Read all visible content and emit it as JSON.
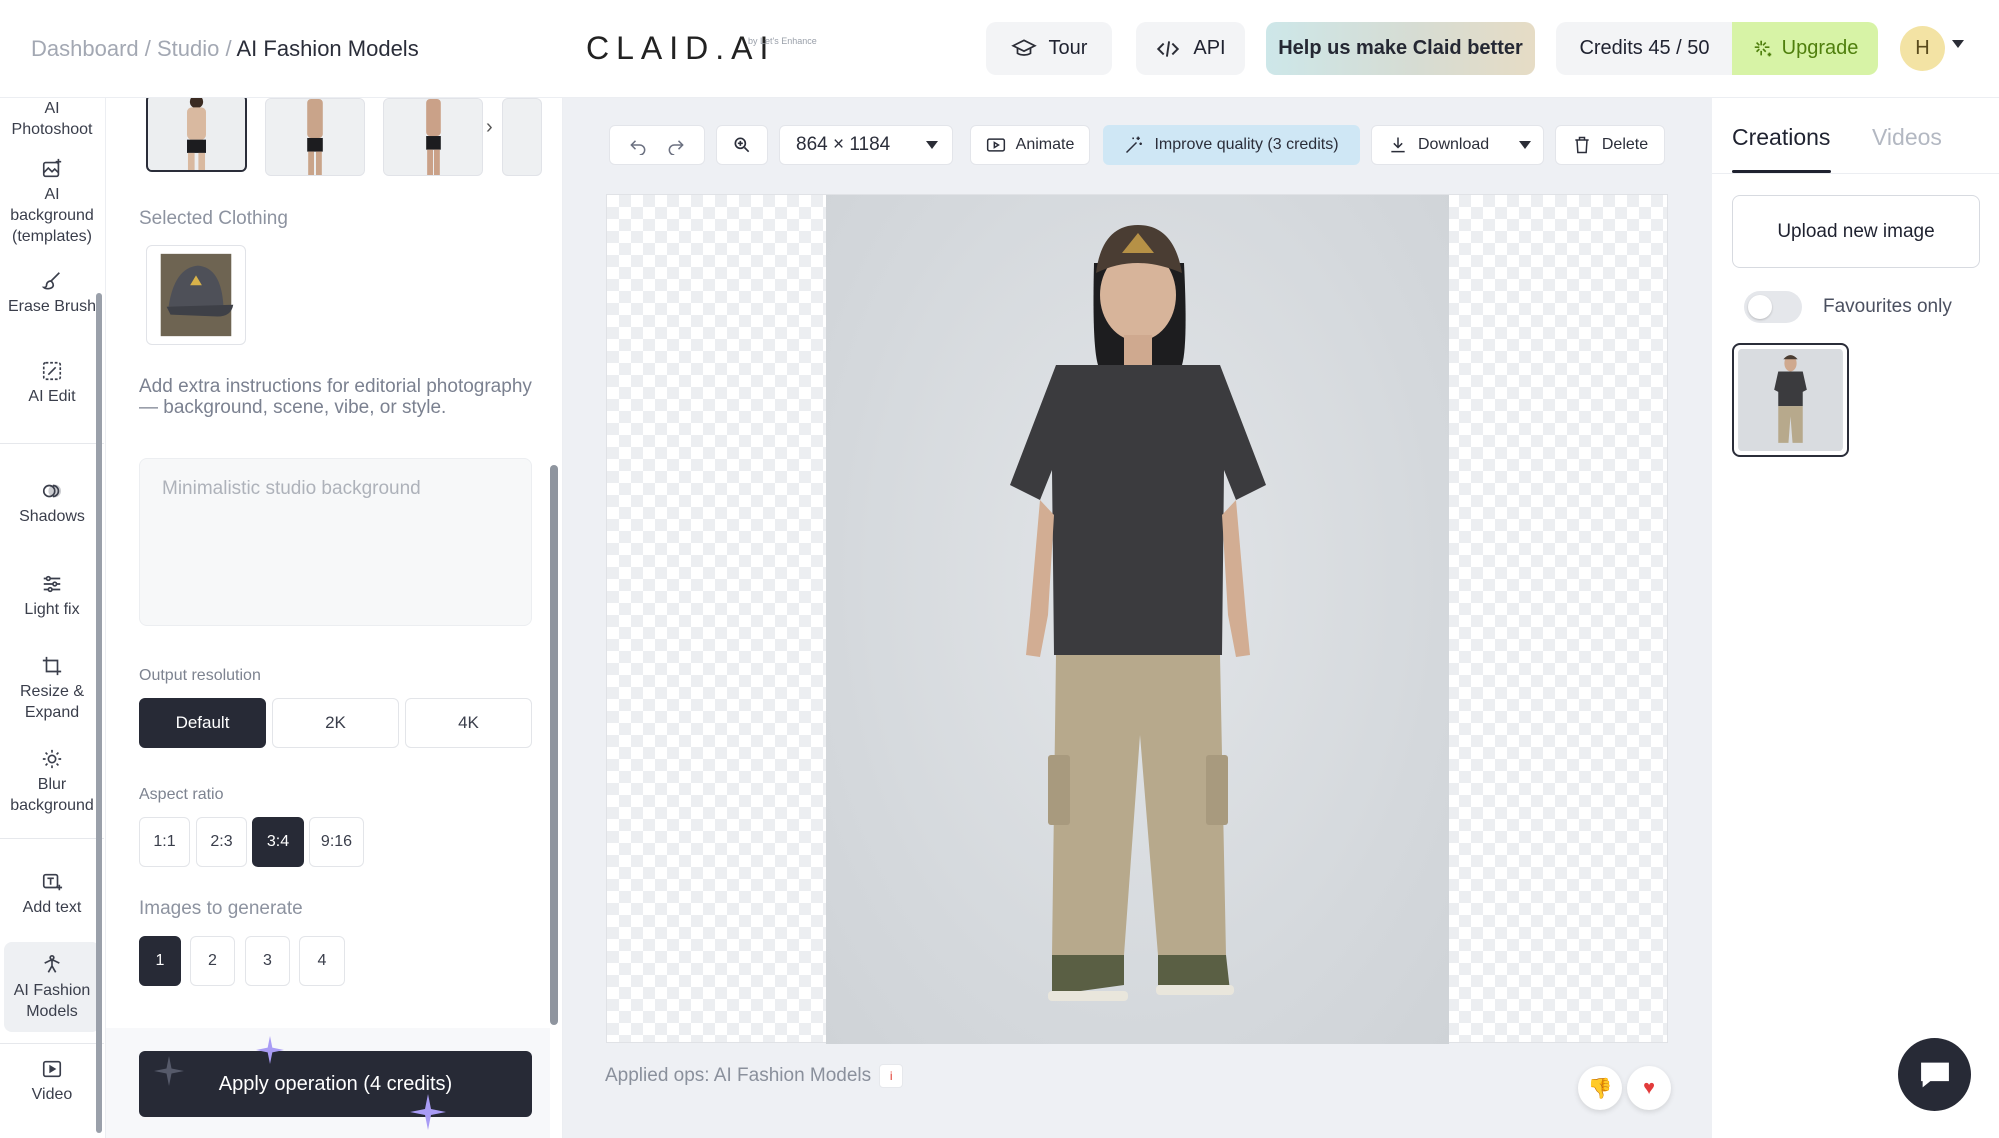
{
  "header": {
    "breadcrumb": {
      "dashboard": "Dashboard",
      "sep1": " / ",
      "studio": "Studio",
      "sep2": " / ",
      "current": "AI Fashion Models"
    },
    "logo": "CLAID.AI",
    "logo_sub": "by Let's Enhance",
    "tour_label": "Tour",
    "api_label": "API",
    "help_label": "Help us make Claid better",
    "credits_label": "Credits 45 / 50",
    "upgrade_label": "Upgrade",
    "avatar_initial": "H"
  },
  "rail": {
    "items": [
      {
        "label_lines": [
          "AI",
          "Photoshoot"
        ],
        "icon": "photoshoot-icon"
      },
      {
        "label_lines": [
          "AI",
          "background",
          "(templates)"
        ],
        "icon": "image-plus-icon"
      },
      {
        "label_lines": [
          "Erase Brush"
        ],
        "icon": "brush-icon"
      },
      {
        "label_lines": [
          "AI Edit"
        ],
        "icon": "ai-edit-icon"
      },
      {
        "label_lines": [
          "Shadows"
        ],
        "icon": "shadows-icon"
      },
      {
        "label_lines": [
          "Light fix"
        ],
        "icon": "sliders-icon"
      },
      {
        "label_lines": [
          "Resize &",
          "Expand"
        ],
        "icon": "crop-icon"
      },
      {
        "label_lines": [
          "Blur",
          "background"
        ],
        "icon": "blur-icon"
      },
      {
        "label_lines": [
          "Add text"
        ],
        "icon": "add-text-icon"
      },
      {
        "label_lines": [
          "AI Fashion",
          "Models"
        ],
        "icon": "fashion-model-icon",
        "active": true
      },
      {
        "label_lines": [
          "Video"
        ],
        "icon": "video-icon"
      }
    ]
  },
  "panel": {
    "selected_clothing_label": "Selected Clothing",
    "instructions_hint": "Add extra instructions for editorial photography — background, scene, vibe, or style.",
    "instructions_placeholder": "Minimalistic studio background",
    "output_resolution_label": "Output resolution",
    "resolutions": [
      "Default",
      "2K",
      "4K"
    ],
    "selected_resolution": "Default",
    "aspect_ratio_label": "Aspect ratio",
    "aspect_ratios": [
      "1:1",
      "2:3",
      "3:4",
      "9:16"
    ],
    "selected_aspect_ratio": "3:4",
    "images_label": "Images to generate",
    "image_counts": [
      "1",
      "2",
      "3",
      "4"
    ],
    "selected_image_count": "1",
    "apply_label": "Apply operation (4 credits)"
  },
  "toolbar": {
    "size_label": "864 × 1184",
    "animate_label": "Animate",
    "improve_label": "Improve quality (3 credits)",
    "download_label": "Download",
    "delete_label": "Delete"
  },
  "canvas": {
    "applied_ops": "Applied ops: AI Fashion Models",
    "info_badge": "i"
  },
  "right": {
    "tab_creations": "Creations",
    "tab_videos": "Videos",
    "upload_label": "Upload new image",
    "favourites_label": "Favourites only"
  },
  "colors": {
    "accent_dark": "#272a36",
    "upgrade_bg": "#d7f3a6",
    "upgrade_text": "#4f7f0d",
    "improve_bg": "#cfe7f5"
  }
}
